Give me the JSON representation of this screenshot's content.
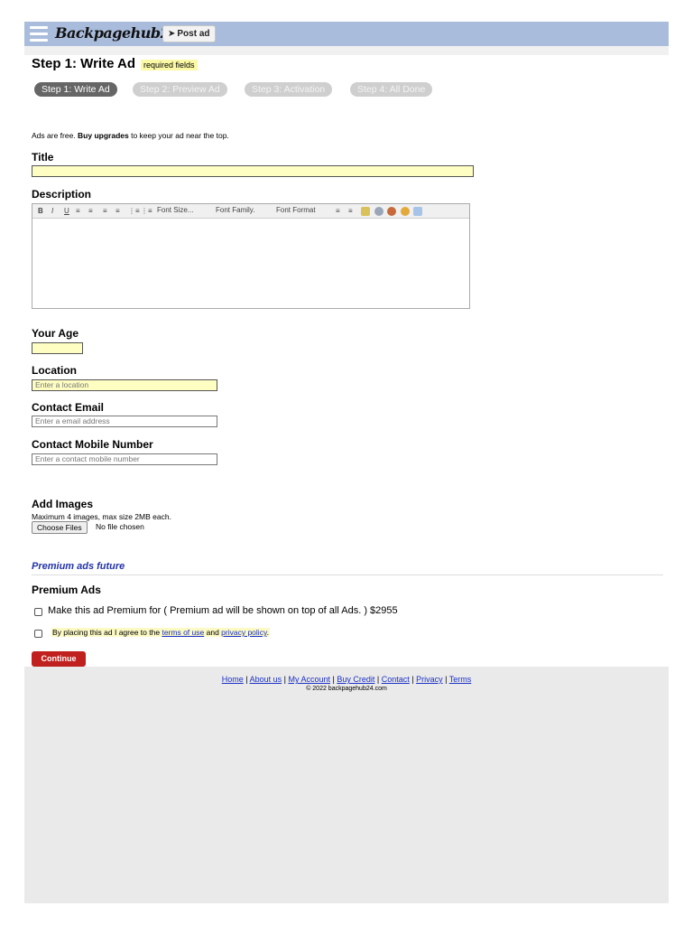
{
  "header": {
    "logo": "Backpagehub24",
    "post_ad_icon": "send-icon",
    "post_ad_label": "Post ad"
  },
  "page": {
    "heading": "Step 1: Write Ad",
    "required_badge": "required fields",
    "steps": [
      "Step 1: Write Ad",
      "Step 2: Preview Ad",
      "Step 3: Activation",
      "Step 4: All Done"
    ],
    "active_step": 0,
    "intro_prefix": "Ads are free.",
    "intro_bold": "Buy upgrades",
    "intro_suffix": "to keep your ad near the top."
  },
  "form": {
    "title_label": "Title",
    "title_value": "",
    "description_label": "Description",
    "editor": {
      "font_size": "Font Size...",
      "font_family": "Font Family.",
      "font_format": "Font Format"
    },
    "age_label": "Your Age",
    "location_label": "Location",
    "location_placeholder": "Enter a location",
    "email_label": "Contact Email",
    "email_placeholder": "Enter a email address",
    "mobile_label": "Contact Mobile Number",
    "mobile_placeholder": "Enter a contact mobile number",
    "images_label": "Add Images",
    "images_hint": "Maximum 4 images, max size 2MB each.",
    "choose_files": "Choose Files",
    "no_file": "No file chosen"
  },
  "premium": {
    "section_title": "Premium ads future",
    "heading": "Premium Ads",
    "option": "Make this ad Premium for ( Premium ad will be shown on top of all Ads. ) $2955",
    "agree_prefix": "By placing this ad I agree to the",
    "terms_link": "terms of use",
    "and": "and",
    "privacy_link": "privacy policy",
    "period": ".",
    "continue": "Continue"
  },
  "footer": {
    "links": [
      "Home",
      "About us",
      "My Account",
      "Buy Credit",
      "Contact",
      "Privacy",
      "Terms"
    ],
    "separator": " | ",
    "copyright": "© 2022 backpagehub24.com"
  },
  "colors": {
    "header_bg": "#a9bcdc",
    "required_bg": "#fbf9a6",
    "input_highlight": "#fefdc2",
    "continue_bg": "#c0201e",
    "link": "#1a2fc7"
  }
}
